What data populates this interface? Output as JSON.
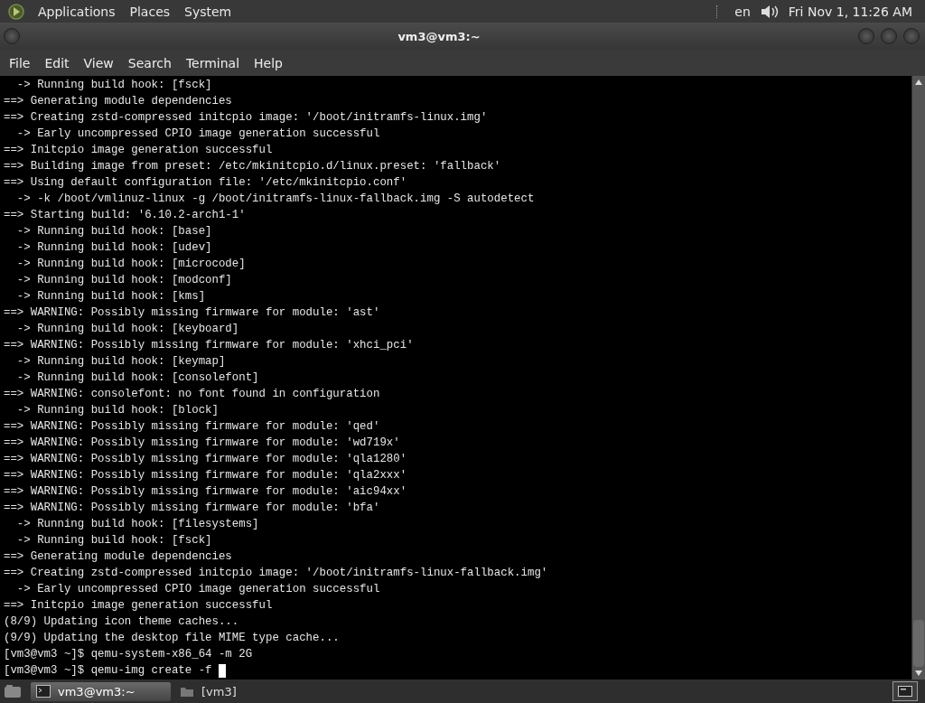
{
  "top_panel": {
    "menus": [
      "Applications",
      "Places",
      "System"
    ],
    "keyboard_layout": "en",
    "clock": "Fri Nov 1, 11:26 AM"
  },
  "window": {
    "title": "vm3@vm3:~"
  },
  "menu_bar": [
    "File",
    "Edit",
    "View",
    "Search",
    "Terminal",
    "Help"
  ],
  "terminal": {
    "lines": [
      "  -> Running build hook: [fsck]",
      "==> Generating module dependencies",
      "==> Creating zstd-compressed initcpio image: '/boot/initramfs-linux.img'",
      "  -> Early uncompressed CPIO image generation successful",
      "==> Initcpio image generation successful",
      "==> Building image from preset: /etc/mkinitcpio.d/linux.preset: 'fallback'",
      "==> Using default configuration file: '/etc/mkinitcpio.conf'",
      "  -> -k /boot/vmlinuz-linux -g /boot/initramfs-linux-fallback.img -S autodetect",
      "==> Starting build: '6.10.2-arch1-1'",
      "  -> Running build hook: [base]",
      "  -> Running build hook: [udev]",
      "  -> Running build hook: [microcode]",
      "  -> Running build hook: [modconf]",
      "  -> Running build hook: [kms]",
      "==> WARNING: Possibly missing firmware for module: 'ast'",
      "  -> Running build hook: [keyboard]",
      "==> WARNING: Possibly missing firmware for module: 'xhci_pci'",
      "  -> Running build hook: [keymap]",
      "  -> Running build hook: [consolefont]",
      "==> WARNING: consolefont: no font found in configuration",
      "  -> Running build hook: [block]",
      "==> WARNING: Possibly missing firmware for module: 'qed'",
      "==> WARNING: Possibly missing firmware for module: 'wd719x'",
      "==> WARNING: Possibly missing firmware for module: 'qla1280'",
      "==> WARNING: Possibly missing firmware for module: 'qla2xxx'",
      "==> WARNING: Possibly missing firmware for module: 'aic94xx'",
      "==> WARNING: Possibly missing firmware for module: 'bfa'",
      "  -> Running build hook: [filesystems]",
      "  -> Running build hook: [fsck]",
      "==> Generating module dependencies",
      "==> Creating zstd-compressed initcpio image: '/boot/initramfs-linux-fallback.img'",
      "  -> Early uncompressed CPIO image generation successful",
      "==> Initcpio image generation successful",
      "(8/9) Updating icon theme caches...",
      "(9/9) Updating the desktop file MIME type cache...",
      "[vm3@vm3 ~]$ qemu-system-x86_64 -m 2G"
    ],
    "command_line": "[vm3@vm3 ~]$ qemu-img create -f "
  },
  "taskbar": {
    "tasks": [
      {
        "label": "vm3@vm3:~",
        "kind": "terminal",
        "selected": true
      },
      {
        "label": "[vm3]",
        "kind": "folder",
        "selected": false
      }
    ]
  }
}
